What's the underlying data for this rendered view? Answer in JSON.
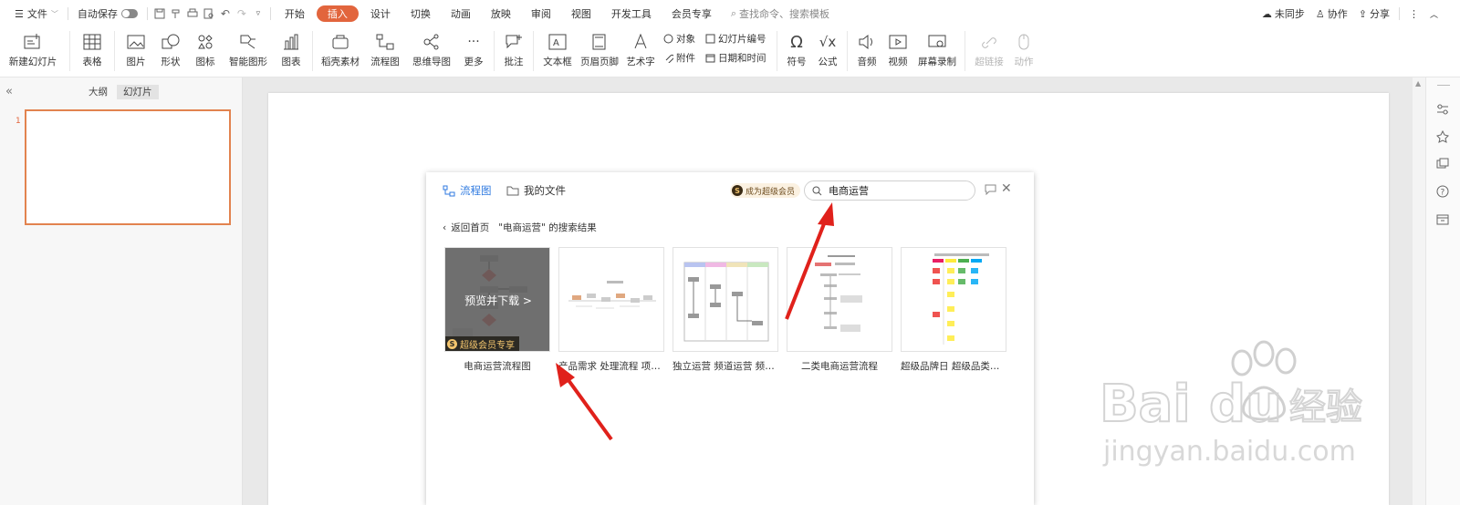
{
  "titlebar": {
    "file_label": "文件",
    "autosave_label": "自动保存",
    "tabs": [
      "开始",
      "插入",
      "设计",
      "切换",
      "动画",
      "放映",
      "审阅",
      "视图",
      "开发工具",
      "会员专享"
    ],
    "active_tab": "插入",
    "command_search_placeholder": "查找命令、搜索模板",
    "sync_label": "未同步",
    "collab_label": "协作",
    "share_label": "分享"
  },
  "ribbon": {
    "new_slide": "新建幻灯片",
    "table": "表格",
    "picture": "图片",
    "shape": "形状",
    "icon": "图标",
    "smart_art": "智能图形",
    "chart": "图表",
    "docer_material": "稻壳素材",
    "flowchart": "流程图",
    "mindmap": "思维导图",
    "more": "更多",
    "comment": "批注",
    "textbox": "文本框",
    "header_footer": "页眉页脚",
    "wordart": "艺术字",
    "object": "对象",
    "attachment": "附件",
    "slide_number": "幻灯片编号",
    "date_time": "日期和时间",
    "symbol": "符号",
    "formula": "公式",
    "audio": "音频",
    "video": "视频",
    "screen_record": "屏幕录制",
    "hyperlink": "超链接",
    "action": "动作"
  },
  "left_pane": {
    "tab_outline": "大纲",
    "tab_slides": "幻灯片",
    "slide_number": "1"
  },
  "dialog": {
    "tab_flowchart": "流程图",
    "tab_myfiles": "我的文件",
    "vip_badge": "成为超级会员",
    "search_value": "电商运营",
    "back_label": "返回首页",
    "result_label": "\"电商运营\" 的搜索结果",
    "hover_action": "预览并下载 >",
    "vip_tag": "超级会员专享",
    "results": [
      {
        "title": "电商运营流程图"
      },
      {
        "title": "产品需求 处理流程 项目..."
      },
      {
        "title": "独立运营 频道运营 频道..."
      },
      {
        "title": "二类电商运营流程"
      },
      {
        "title": "超级品牌日 超级品类日 ..."
      }
    ]
  },
  "colors": {
    "accent": "#e2653d",
    "thumb_border": "#e2834f",
    "arrow": "#e0211b"
  }
}
